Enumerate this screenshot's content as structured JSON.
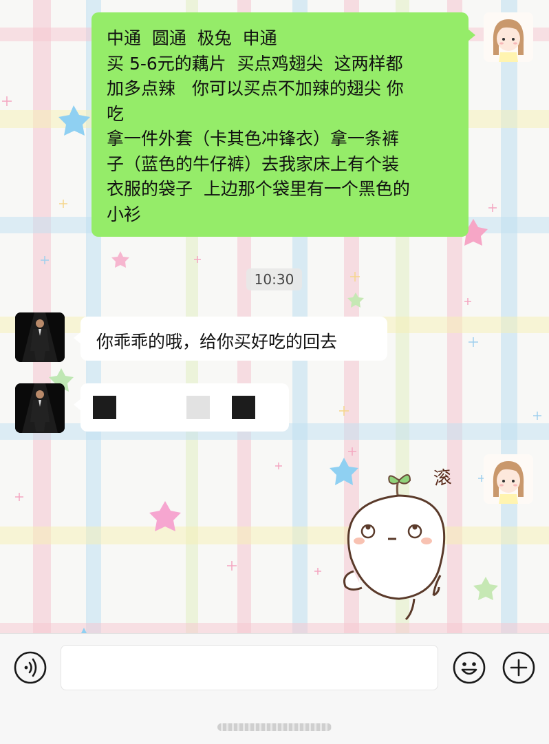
{
  "messages": {
    "outgoing_1": {
      "lines": [
        "中通  圆通  极兔  申通",
        "买 5-6元的藕片  买点鸡翅尖  这两样都",
        "加多点辣   你可以买点不加辣的翅尖 你",
        "吃",
        "拿一件外套（卡其色冲锋衣）拿一条裤",
        "子（蓝色的牛仔裤）去我家床上有个装",
        "衣服的袋子  上边那个袋里有一个黑色的",
        "小衫"
      ]
    },
    "timestamp": "10:30",
    "incoming_1": {
      "text": "你乖乖的哦，给你买好吃的回去"
    },
    "incoming_2": {
      "text": ""
    },
    "sticker": {
      "caption": "滚"
    }
  },
  "input_bar": {
    "voice_icon": "voice-icon",
    "emoji_icon": "emoji-icon",
    "plus_icon": "plus-icon",
    "input_value": ""
  },
  "colors": {
    "outgoing_bubble": "#95ec69",
    "incoming_bubble": "#ffffff",
    "background": "#f6f7f4"
  }
}
